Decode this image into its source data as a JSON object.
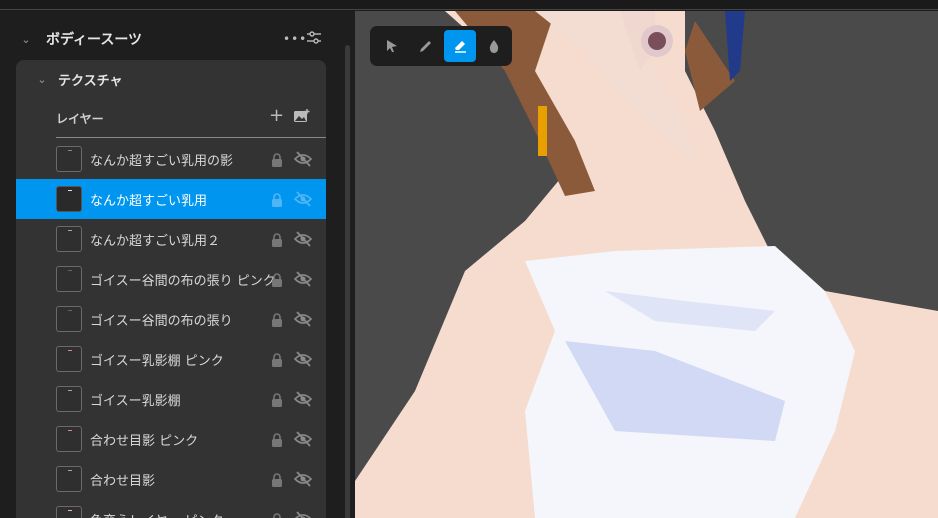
{
  "section": {
    "title": "ボディースーツ",
    "more": "•••"
  },
  "panel": {
    "title": "テクスチャ",
    "layers_label": "レイヤー",
    "add": "+"
  },
  "layers": [
    {
      "name": "なんか超すごい乳用の影",
      "selected": false,
      "thumb": "#888"
    },
    {
      "name": "なんか超すごい乳用",
      "selected": true,
      "thumb": "#ddd"
    },
    {
      "name": "なんか超すごい乳用２",
      "selected": false,
      "thumb": "#aaa"
    },
    {
      "name": "ゴイスー谷間の布の張り ピンク",
      "selected": false,
      "thumb": "#666"
    },
    {
      "name": "ゴイスー谷間の布の張り",
      "selected": false,
      "thumb": "#666"
    },
    {
      "name": "ゴイスー乳影棚 ピンク",
      "selected": false,
      "thumb": "#c8a"
    },
    {
      "name": "ゴイスー乳影棚",
      "selected": false,
      "thumb": "#9ac"
    },
    {
      "name": "合わせ目影 ピンク",
      "selected": false,
      "thumb": "#c8a"
    },
    {
      "name": "合わせ目影",
      "selected": false,
      "thumb": "#9ac"
    },
    {
      "name": "色変えレイヤー ピンク",
      "selected": false,
      "thumb": "#f0b0d8"
    }
  ],
  "tools": [
    {
      "name": "select",
      "active": false
    },
    {
      "name": "pen",
      "active": false
    },
    {
      "name": "eraser",
      "active": true
    },
    {
      "name": "fill",
      "active": false
    }
  ],
  "colors": {
    "accent": "#0096f0"
  }
}
